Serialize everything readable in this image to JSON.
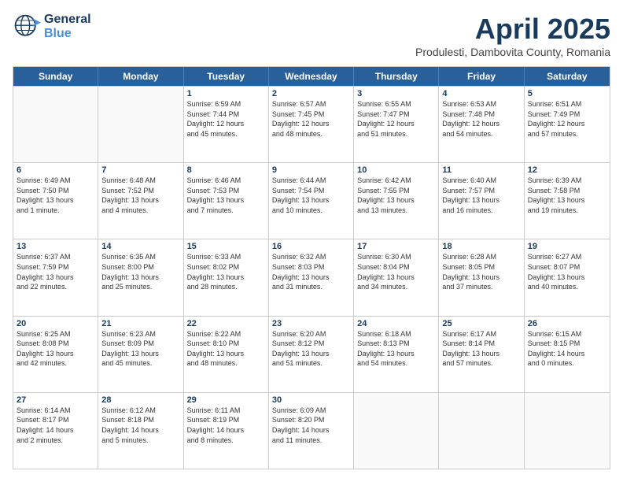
{
  "header": {
    "logo_general": "General",
    "logo_blue": "Blue",
    "month_title": "April 2025",
    "subtitle": "Produlesti, Dambovita County, Romania"
  },
  "weekdays": [
    "Sunday",
    "Monday",
    "Tuesday",
    "Wednesday",
    "Thursday",
    "Friday",
    "Saturday"
  ],
  "weeks": [
    [
      {
        "day": "",
        "info": ""
      },
      {
        "day": "",
        "info": ""
      },
      {
        "day": "1",
        "info": "Sunrise: 6:59 AM\nSunset: 7:44 PM\nDaylight: 12 hours\nand 45 minutes."
      },
      {
        "day": "2",
        "info": "Sunrise: 6:57 AM\nSunset: 7:45 PM\nDaylight: 12 hours\nand 48 minutes."
      },
      {
        "day": "3",
        "info": "Sunrise: 6:55 AM\nSunset: 7:47 PM\nDaylight: 12 hours\nand 51 minutes."
      },
      {
        "day": "4",
        "info": "Sunrise: 6:53 AM\nSunset: 7:48 PM\nDaylight: 12 hours\nand 54 minutes."
      },
      {
        "day": "5",
        "info": "Sunrise: 6:51 AM\nSunset: 7:49 PM\nDaylight: 12 hours\nand 57 minutes."
      }
    ],
    [
      {
        "day": "6",
        "info": "Sunrise: 6:49 AM\nSunset: 7:50 PM\nDaylight: 13 hours\nand 1 minute."
      },
      {
        "day": "7",
        "info": "Sunrise: 6:48 AM\nSunset: 7:52 PM\nDaylight: 13 hours\nand 4 minutes."
      },
      {
        "day": "8",
        "info": "Sunrise: 6:46 AM\nSunset: 7:53 PM\nDaylight: 13 hours\nand 7 minutes."
      },
      {
        "day": "9",
        "info": "Sunrise: 6:44 AM\nSunset: 7:54 PM\nDaylight: 13 hours\nand 10 minutes."
      },
      {
        "day": "10",
        "info": "Sunrise: 6:42 AM\nSunset: 7:55 PM\nDaylight: 13 hours\nand 13 minutes."
      },
      {
        "day": "11",
        "info": "Sunrise: 6:40 AM\nSunset: 7:57 PM\nDaylight: 13 hours\nand 16 minutes."
      },
      {
        "day": "12",
        "info": "Sunrise: 6:39 AM\nSunset: 7:58 PM\nDaylight: 13 hours\nand 19 minutes."
      }
    ],
    [
      {
        "day": "13",
        "info": "Sunrise: 6:37 AM\nSunset: 7:59 PM\nDaylight: 13 hours\nand 22 minutes."
      },
      {
        "day": "14",
        "info": "Sunrise: 6:35 AM\nSunset: 8:00 PM\nDaylight: 13 hours\nand 25 minutes."
      },
      {
        "day": "15",
        "info": "Sunrise: 6:33 AM\nSunset: 8:02 PM\nDaylight: 13 hours\nand 28 minutes."
      },
      {
        "day": "16",
        "info": "Sunrise: 6:32 AM\nSunset: 8:03 PM\nDaylight: 13 hours\nand 31 minutes."
      },
      {
        "day": "17",
        "info": "Sunrise: 6:30 AM\nSunset: 8:04 PM\nDaylight: 13 hours\nand 34 minutes."
      },
      {
        "day": "18",
        "info": "Sunrise: 6:28 AM\nSunset: 8:05 PM\nDaylight: 13 hours\nand 37 minutes."
      },
      {
        "day": "19",
        "info": "Sunrise: 6:27 AM\nSunset: 8:07 PM\nDaylight: 13 hours\nand 40 minutes."
      }
    ],
    [
      {
        "day": "20",
        "info": "Sunrise: 6:25 AM\nSunset: 8:08 PM\nDaylight: 13 hours\nand 42 minutes."
      },
      {
        "day": "21",
        "info": "Sunrise: 6:23 AM\nSunset: 8:09 PM\nDaylight: 13 hours\nand 45 minutes."
      },
      {
        "day": "22",
        "info": "Sunrise: 6:22 AM\nSunset: 8:10 PM\nDaylight: 13 hours\nand 48 minutes."
      },
      {
        "day": "23",
        "info": "Sunrise: 6:20 AM\nSunset: 8:12 PM\nDaylight: 13 hours\nand 51 minutes."
      },
      {
        "day": "24",
        "info": "Sunrise: 6:18 AM\nSunset: 8:13 PM\nDaylight: 13 hours\nand 54 minutes."
      },
      {
        "day": "25",
        "info": "Sunrise: 6:17 AM\nSunset: 8:14 PM\nDaylight: 13 hours\nand 57 minutes."
      },
      {
        "day": "26",
        "info": "Sunrise: 6:15 AM\nSunset: 8:15 PM\nDaylight: 14 hours\nand 0 minutes."
      }
    ],
    [
      {
        "day": "27",
        "info": "Sunrise: 6:14 AM\nSunset: 8:17 PM\nDaylight: 14 hours\nand 2 minutes."
      },
      {
        "day": "28",
        "info": "Sunrise: 6:12 AM\nSunset: 8:18 PM\nDaylight: 14 hours\nand 5 minutes."
      },
      {
        "day": "29",
        "info": "Sunrise: 6:11 AM\nSunset: 8:19 PM\nDaylight: 14 hours\nand 8 minutes."
      },
      {
        "day": "30",
        "info": "Sunrise: 6:09 AM\nSunset: 8:20 PM\nDaylight: 14 hours\nand 11 minutes."
      },
      {
        "day": "",
        "info": ""
      },
      {
        "day": "",
        "info": ""
      },
      {
        "day": "",
        "info": ""
      }
    ]
  ]
}
